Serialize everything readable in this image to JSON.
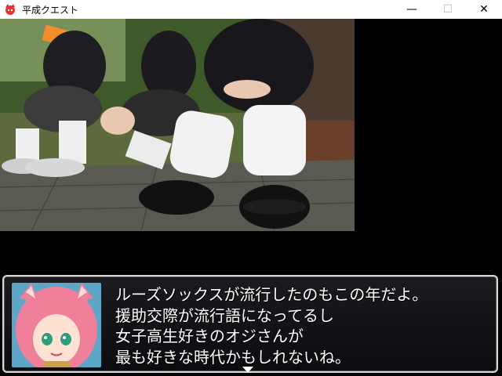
{
  "window": {
    "title": "平成クエスト",
    "controls": {
      "minimize": "—",
      "maximize": "☐",
      "close": "✕"
    }
  },
  "scene": {
    "icon": "photo-students-loose-socks"
  },
  "dialog": {
    "lines": [
      "ルーズソックスが流行したのもこの年だよ。",
      "援助交際が流行語になってるし",
      "女子高生好きのオジさんが",
      "最も好きな時代かもしれないね。"
    ],
    "portrait_icon": "pink-haired-catgirl-portrait",
    "next_indicator_icon": "next-arrow-icon"
  },
  "colors": {
    "titlebar": "#ffffff",
    "background": "#000000",
    "dialog_border": "#d8d8d8",
    "text": "#ffffff"
  }
}
